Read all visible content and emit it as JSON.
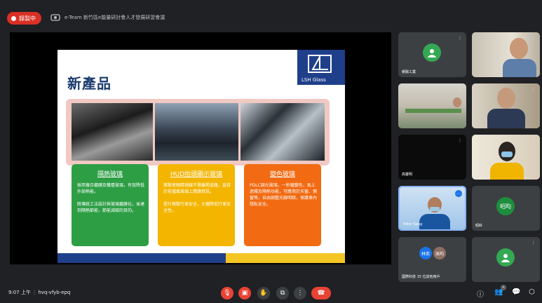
{
  "top_bar": {
    "recording_label": "錄製中",
    "meeting_title": "e-Team 新竹區e能量研討會人才發展研習會議"
  },
  "slide": {
    "title": "新產品",
    "logo_text": "LSH Glass",
    "cards": [
      {
        "title": "隔熱玻璃",
        "body": "採用複合鍍膜及雙層玻璃，有效降低外部熱能。\n\n將傳統工法設計與玻璃鍍膜化，並達到隔熱節能，節能減碳的目的。"
      },
      {
        "title": "HUD抬頭顯示玻璃",
        "body": "駕駛者眼睛視線不需離開道路，直接於前擋風玻璃上閱讀資訊。\n\n提升駕駛行車安全，大幅降低行車安全性。"
      },
      {
        "title": "變色玻璃",
        "body": "PDLC調光玻璃，一秒鐘變色，馬上遮陽及隔熱功能，可應用於天窗、側窗等，自由調整光線明暗，保護車內隱私安全。"
      }
    ]
  },
  "participants": [
    {
      "name": "朝陽工業",
      "type": "avatar",
      "color": "#34a853",
      "initial": ""
    },
    {
      "name": "",
      "type": "video",
      "initial": ""
    },
    {
      "name": "",
      "type": "video-room",
      "initial": ""
    },
    {
      "name": "",
      "type": "video",
      "initial": ""
    },
    {
      "name": "高雄明",
      "type": "dark",
      "initial": ""
    },
    {
      "name": "",
      "type": "video",
      "initial": ""
    },
    {
      "name": "Peter Sang",
      "type": "video-speaking",
      "initial": ""
    },
    {
      "name": "昭岭",
      "type": "avatar",
      "color": "#1e8e3e",
      "initial": "昭昀"
    },
    {
      "name": "國際科技 15 位其他用戶",
      "type": "group",
      "initial": ""
    },
    {
      "name": "",
      "type": "avatar",
      "color": "#34a853",
      "initial": ""
    }
  ],
  "bottom_bar": {
    "time": "9:07 上午",
    "meeting_code": "hvq-vfyb-epq"
  },
  "colors": {
    "background": "#202124",
    "red": "#ea4335",
    "green": "#34a853",
    "slide_blue": "#1f3f8a"
  }
}
